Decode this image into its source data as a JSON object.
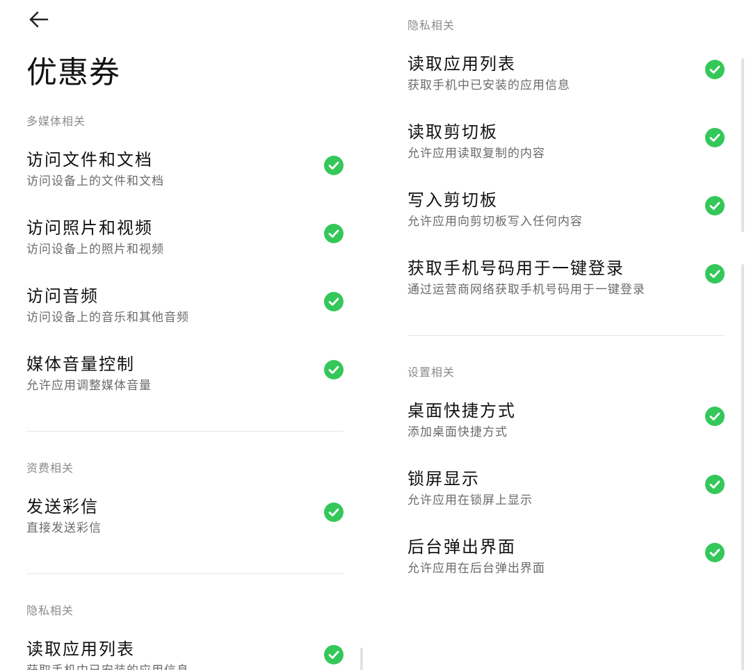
{
  "header": {
    "back_icon": "arrow-left-icon",
    "title": "优惠券"
  },
  "accent_color": "#34c759",
  "left": {
    "sections": [
      {
        "label": "多媒体相关",
        "items": [
          {
            "title": "访问文件和文档",
            "desc": "访问设备上的文件和文档"
          },
          {
            "title": "访问照片和视频",
            "desc": "访问设备上的照片和视频"
          },
          {
            "title": "访问音频",
            "desc": "访问设备上的音乐和其他音频"
          },
          {
            "title": "媒体音量控制",
            "desc": "允许应用调整媒体音量"
          }
        ]
      },
      {
        "label": "资费相关",
        "items": [
          {
            "title": "发送彩信",
            "desc": "直接发送彩信"
          }
        ]
      },
      {
        "label": "隐私相关",
        "items": [
          {
            "title": "读取应用列表",
            "desc": "获取手机中已安装的应用信息"
          }
        ]
      }
    ]
  },
  "right": {
    "sections": [
      {
        "label": "隐私相关",
        "items": [
          {
            "title": "读取应用列表",
            "desc": "获取手机中已安装的应用信息"
          },
          {
            "title": "读取剪切板",
            "desc": "允许应用读取复制的内容"
          },
          {
            "title": "写入剪切板",
            "desc": "允许应用向剪切板写入任何内容"
          },
          {
            "title": "获取手机号码用于一键登录",
            "desc": "通过运营商网络获取手机号码用于一键登录"
          }
        ]
      },
      {
        "label": "设置相关",
        "items": [
          {
            "title": "桌面快捷方式",
            "desc": "添加桌面快捷方式"
          },
          {
            "title": "锁屏显示",
            "desc": "允许应用在锁屏上显示"
          },
          {
            "title": "后台弹出界面",
            "desc": "允许应用在后台弹出界面"
          }
        ]
      }
    ]
  }
}
